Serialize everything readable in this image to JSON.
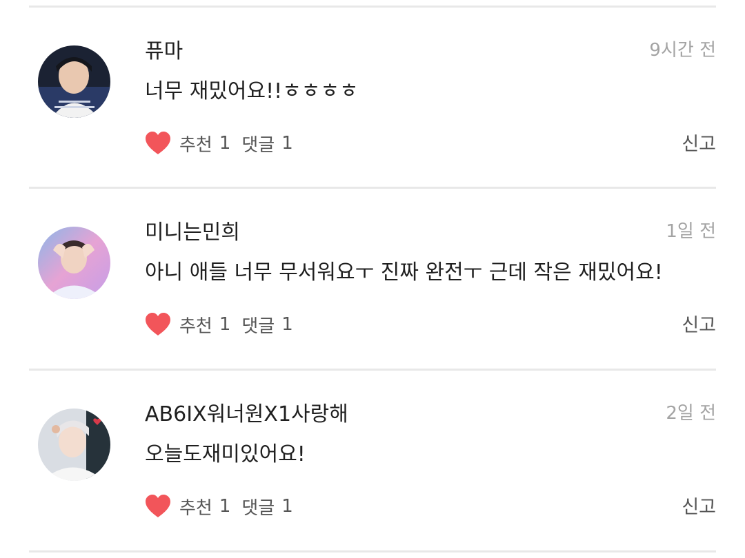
{
  "comments": [
    {
      "username": "퓨마",
      "time": "9시간 전",
      "text": "너무 재밌어요!!ㅎㅎㅎㅎ",
      "like_label": "추천",
      "like_count": "1",
      "reply_label": "댓글",
      "reply_count": "1",
      "report_label": "신고",
      "avatar_icon": "user-avatar-photo"
    },
    {
      "username": "미니는민희",
      "time": "1일 전",
      "text": "아니 애들 너무 무서워요ㅜ 진짜 완전ㅜ 근데 작은 재밌어요!",
      "like_label": "추천",
      "like_count": "1",
      "reply_label": "댓글",
      "reply_count": "1",
      "report_label": "신고",
      "avatar_icon": "user-avatar-photo"
    },
    {
      "username": "AB6IX워너원X1사랑해",
      "time": "2일 전",
      "text": "오늘도재미있어요!",
      "like_label": "추천",
      "like_count": "1",
      "reply_label": "댓글",
      "reply_count": "1",
      "report_label": "신고",
      "avatar_icon": "user-avatar-photo"
    }
  ],
  "colors": {
    "heart": "#f2555a",
    "divider": "#e8e8e8",
    "time_text": "#a3a3a3",
    "action_text": "#555555"
  },
  "icons": {
    "like": "heart-icon"
  }
}
